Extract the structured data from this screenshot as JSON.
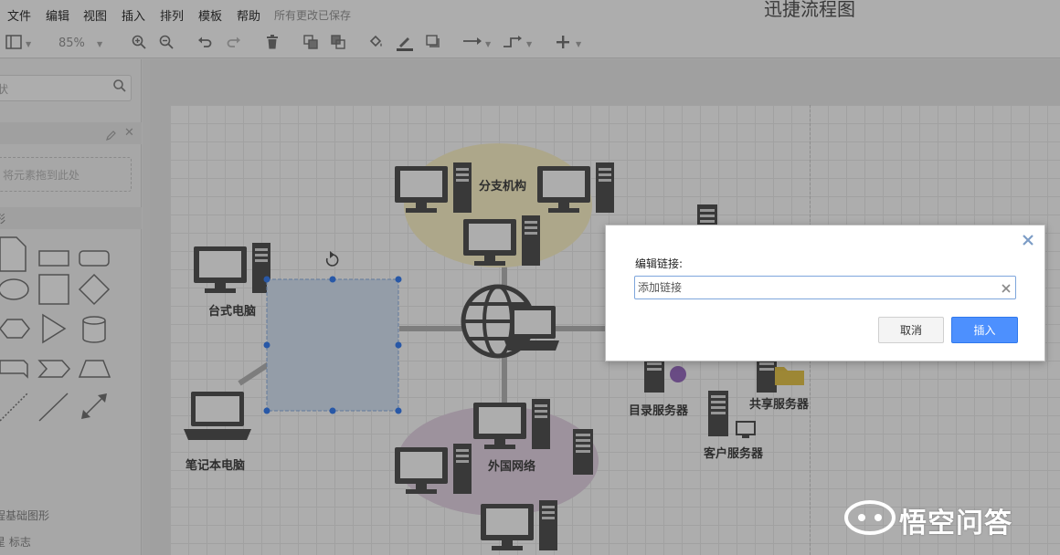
{
  "menu": {
    "items": [
      "文件",
      "编辑",
      "视图",
      "插入",
      "排列",
      "模板",
      "帮助"
    ],
    "save_status": "所有更改已保存",
    "doc_title": "迅捷流程图"
  },
  "toolbar": {
    "zoom": "85%"
  },
  "sidebar": {
    "search_placeholder": "状",
    "drop_hint": "将元素拖到此处",
    "shapes_section": "形",
    "footer_items": [
      "程基础图形",
      "星 标志"
    ]
  },
  "diagram": {
    "labels": {
      "branch": "分支机构",
      "desktop": "台式电脑",
      "laptop": "笔记本电脑",
      "foreign": "外国网络",
      "directory": "目录服务器",
      "shared": "共享服务器",
      "client": "客户服务器"
    }
  },
  "dialog": {
    "title": "编辑链接:",
    "input_placeholder": "添加链接",
    "input_value": "",
    "cancel_label": "取消",
    "insert_label": "插入"
  },
  "watermark": {
    "text": "悟空问答"
  },
  "colors": {
    "accent": "#4d90fe",
    "input_border": "#7ea6dc"
  }
}
